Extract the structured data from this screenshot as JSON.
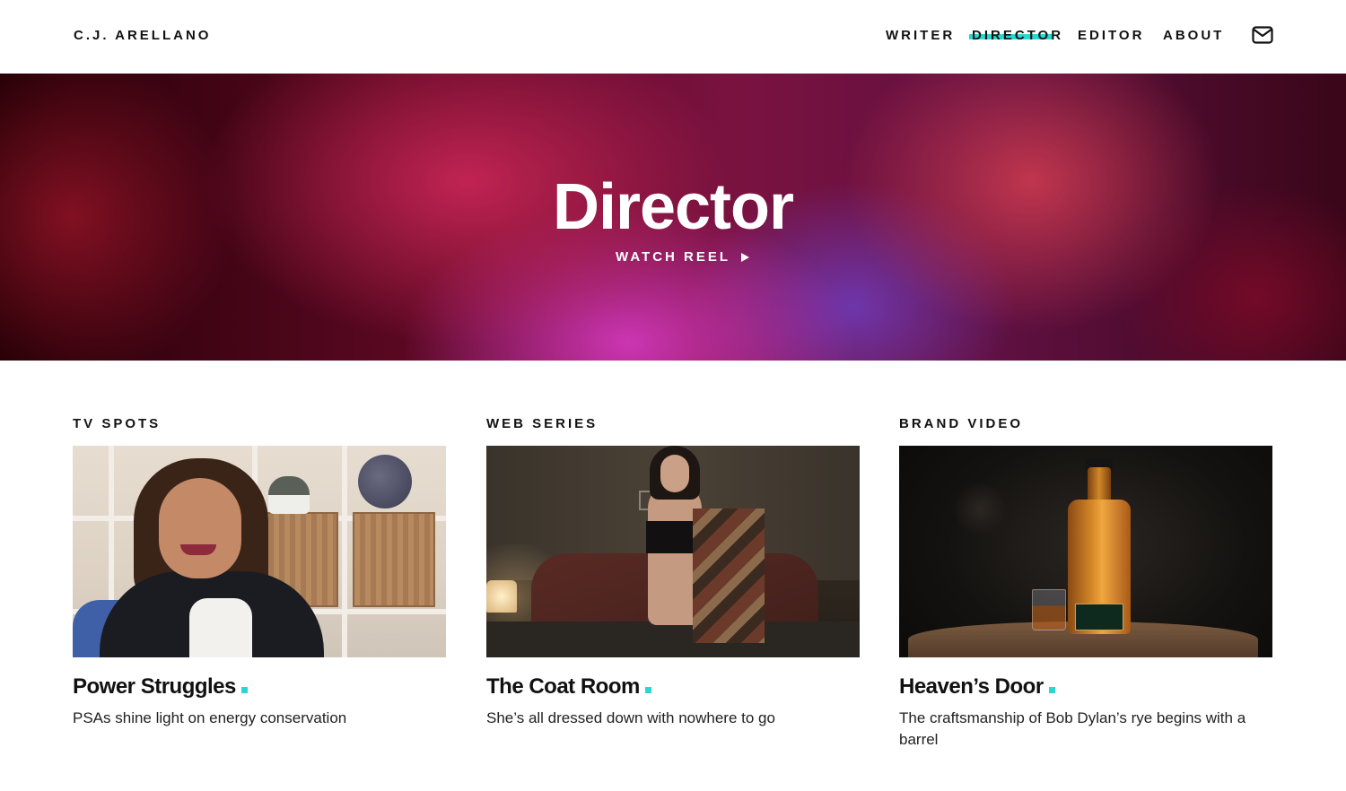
{
  "site": {
    "brand": "C.J. ARELLANO"
  },
  "nav": {
    "items": [
      {
        "label": "WRITER"
      },
      {
        "label": "DIRECTOR"
      },
      {
        "label": "EDITOR"
      },
      {
        "label": "ABOUT"
      }
    ],
    "active": "DIRECTOR",
    "mail_icon": "mail-icon"
  },
  "hero": {
    "title": "Director",
    "watch_label": "WATCH REEL",
    "play_icon": "play-icon"
  },
  "colors": {
    "accent": "#29d8d2",
    "text": "#111111",
    "background": "#ffffff"
  },
  "cards": [
    {
      "category": "TV SPOTS",
      "title": "Power Struggles",
      "description": "PSAs shine light on energy conservation"
    },
    {
      "category": "WEB SERIES",
      "title": "The Coat Room",
      "description": "She’s all dressed down with nowhere to go"
    },
    {
      "category": "BRAND VIDEO",
      "title": "Heaven’s Door",
      "description": "The craftsmanship of Bob Dylan’s rye begins with a barrel"
    }
  ]
}
